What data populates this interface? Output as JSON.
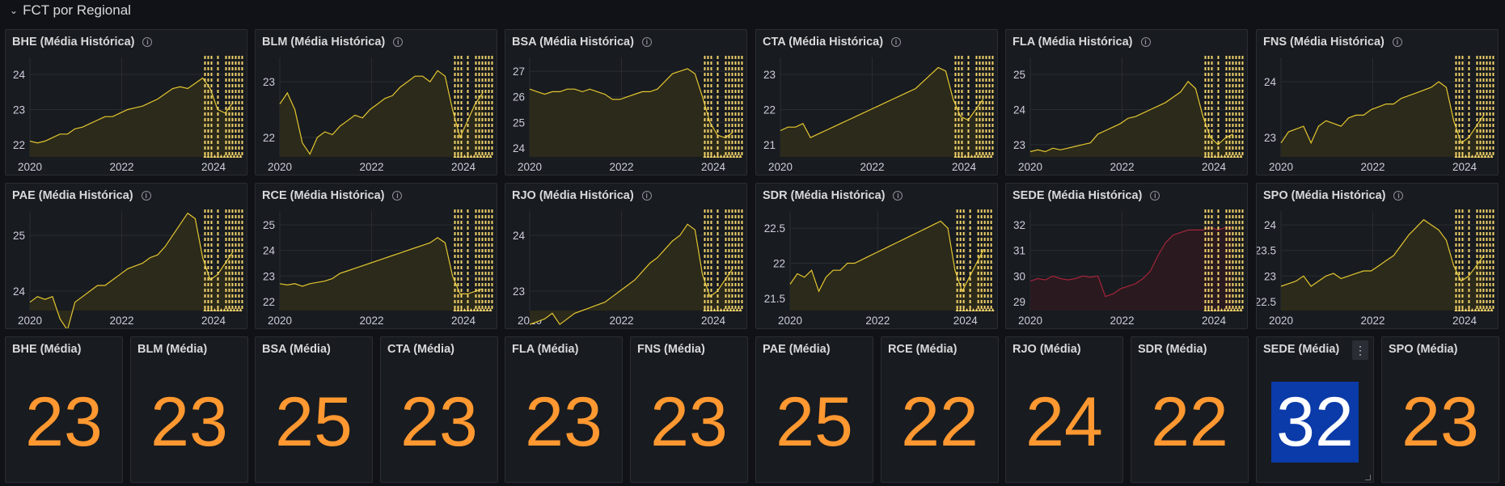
{
  "row": {
    "title": "FCT por Regional",
    "chevron": "chevron-down-icon"
  },
  "colors": {
    "line": "#e3c631",
    "fill": "#2c2a1a",
    "alert_line": "#a3243a",
    "alert_fill": "#2a1a1f",
    "stat": "#ff9830",
    "highlight_bg": "#0b3aa9"
  },
  "x_ticks": [
    "2020",
    "2022",
    "2024"
  ],
  "charts": [
    {
      "title": "BHE (Média Histórica)",
      "yticks": [
        "24",
        "23",
        "22"
      ],
      "series": [
        22.1,
        22.05,
        22.1,
        22.2,
        22.3,
        22.3,
        22.45,
        22.5,
        22.6,
        22.7,
        22.8,
        22.8,
        22.9,
        23.0,
        23.05,
        23.1,
        23.2,
        23.3,
        23.45,
        23.6,
        23.65,
        23.6,
        23.75,
        23.9,
        23.6,
        23.0,
        22.9,
        23.2
      ]
    },
    {
      "title": "BLM (Média Histórica)",
      "yticks": [
        "23",
        "22"
      ],
      "series": [
        22.6,
        22.8,
        22.5,
        21.9,
        21.7,
        22.0,
        22.1,
        22.05,
        22.2,
        22.3,
        22.4,
        22.35,
        22.5,
        22.6,
        22.7,
        22.75,
        22.9,
        23.0,
        23.1,
        23.1,
        23.0,
        23.2,
        23.1,
        22.5,
        22.0,
        22.3,
        22.6,
        22.8
      ]
    },
    {
      "title": "BSA (Média Histórica)",
      "yticks": [
        "27",
        "26",
        "25",
        "24"
      ],
      "series": [
        26.3,
        26.2,
        26.1,
        26.2,
        26.2,
        26.3,
        26.3,
        26.2,
        26.3,
        26.2,
        26.1,
        25.9,
        25.9,
        26.0,
        26.1,
        26.2,
        26.2,
        26.3,
        26.6,
        26.9,
        27.0,
        27.1,
        26.9,
        26.0,
        25.0,
        24.5,
        24.4,
        24.6
      ]
    },
    {
      "title": "CTA (Média Histórica)",
      "yticks": [
        "23",
        "22",
        "21"
      ],
      "series": [
        21.4,
        21.5,
        21.5,
        21.6,
        21.2,
        21.3,
        21.4,
        21.5,
        21.6,
        21.7,
        21.8,
        21.9,
        22.0,
        22.1,
        22.2,
        22.3,
        22.4,
        22.5,
        22.6,
        22.8,
        23.0,
        23.2,
        23.1,
        22.3,
        21.8,
        21.7,
        22.0,
        22.3
      ]
    },
    {
      "title": "FLA (Média Histórica)",
      "yticks": [
        "25",
        "24",
        "23"
      ],
      "series": [
        22.8,
        22.85,
        22.8,
        22.9,
        22.85,
        22.9,
        22.95,
        23.0,
        23.05,
        23.3,
        23.4,
        23.5,
        23.6,
        23.75,
        23.8,
        23.9,
        24.0,
        24.1,
        24.2,
        24.35,
        24.5,
        24.8,
        24.6,
        23.8,
        23.2,
        23.0,
        23.2,
        23.3
      ]
    },
    {
      "title": "FNS (Média Histórica)",
      "yticks": [
        "24",
        "23"
      ],
      "series": [
        22.9,
        23.1,
        23.15,
        23.2,
        22.9,
        23.2,
        23.3,
        23.25,
        23.2,
        23.35,
        23.4,
        23.4,
        23.5,
        23.55,
        23.6,
        23.6,
        23.7,
        23.75,
        23.8,
        23.85,
        23.9,
        24.0,
        23.9,
        23.3,
        22.9,
        23.0,
        23.2,
        23.4
      ]
    },
    {
      "title": "PAE (Média Histórica)",
      "yticks": [
        "25",
        "24"
      ],
      "series": [
        23.8,
        23.9,
        23.85,
        23.9,
        23.5,
        23.3,
        23.8,
        23.9,
        24.0,
        24.1,
        24.1,
        24.2,
        24.3,
        24.4,
        24.45,
        24.5,
        24.6,
        24.65,
        24.8,
        25.0,
        25.2,
        25.4,
        25.3,
        24.6,
        24.2,
        24.3,
        24.5,
        24.7
      ]
    },
    {
      "title": "RCE (Média Histórica)",
      "yticks": [
        "25",
        "24",
        "23",
        "22"
      ],
      "series": [
        22.7,
        22.65,
        22.7,
        22.6,
        22.7,
        22.75,
        22.8,
        22.9,
        23.1,
        23.2,
        23.3,
        23.4,
        23.5,
        23.6,
        23.7,
        23.8,
        23.9,
        24.0,
        24.1,
        24.2,
        24.3,
        24.5,
        24.3,
        23.0,
        22.3,
        22.3,
        22.4,
        22.5
      ]
    },
    {
      "title": "RJO (Média Histórica)",
      "yticks": [
        "24",
        "23"
      ],
      "series": [
        22.4,
        22.45,
        22.5,
        22.6,
        22.4,
        22.5,
        22.6,
        22.65,
        22.7,
        22.75,
        22.8,
        22.9,
        23.0,
        23.1,
        23.2,
        23.35,
        23.5,
        23.6,
        23.75,
        23.9,
        24.0,
        24.2,
        24.1,
        23.3,
        22.9,
        23.0,
        23.2,
        23.4
      ]
    },
    {
      "title": "SDR (Média Histórica)",
      "yticks": [
        "22.5",
        "22",
        "21.5"
      ],
      "series": [
        21.7,
        21.85,
        21.8,
        21.9,
        21.6,
        21.8,
        21.9,
        21.9,
        22.0,
        22.0,
        22.05,
        22.1,
        22.15,
        22.2,
        22.25,
        22.3,
        22.35,
        22.4,
        22.45,
        22.5,
        22.55,
        22.6,
        22.5,
        21.9,
        21.6,
        21.8,
        22.0,
        22.2
      ]
    },
    {
      "title": "SEDE (Média Histórica)",
      "yticks": [
        "32",
        "31",
        "30",
        "29"
      ],
      "series": [
        29.8,
        29.9,
        29.85,
        30.0,
        29.9,
        29.85,
        29.9,
        30.0,
        29.95,
        30.0,
        29.2,
        29.3,
        29.5,
        29.6,
        29.7,
        29.9,
        30.2,
        30.8,
        31.3,
        31.6,
        31.7,
        31.8,
        31.8,
        31.8,
        31.9,
        31.8,
        31.9,
        31.9
      ],
      "alert": true
    },
    {
      "title": "SPO (Média Histórica)",
      "yticks": [
        "24",
        "23.5",
        "23",
        "22.5"
      ],
      "series": [
        22.8,
        22.85,
        22.9,
        23.0,
        22.8,
        22.9,
        23.0,
        23.05,
        22.95,
        23.0,
        23.05,
        23.1,
        23.1,
        23.2,
        23.3,
        23.4,
        23.6,
        23.8,
        23.95,
        24.1,
        24.0,
        23.9,
        23.7,
        23.2,
        22.9,
        23.0,
        23.2,
        23.4
      ]
    }
  ],
  "stats": [
    {
      "title": "BHE (Média)",
      "value": "23"
    },
    {
      "title": "BLM (Média)",
      "value": "23"
    },
    {
      "title": "BSA (Média)",
      "value": "25"
    },
    {
      "title": "CTA (Média)",
      "value": "23"
    },
    {
      "title": "FLA (Média)",
      "value": "23"
    },
    {
      "title": "FNS (Média)",
      "value": "23"
    },
    {
      "title": "PAE (Média)",
      "value": "25"
    },
    {
      "title": "RCE (Média)",
      "value": "22"
    },
    {
      "title": "RJO (Média)",
      "value": "24"
    },
    {
      "title": "SDR (Média)",
      "value": "22"
    },
    {
      "title": "SEDE (Média)",
      "value": "32",
      "highlight": true,
      "menu_icon": "more-vertical-icon"
    },
    {
      "title": "SPO (Média)",
      "value": "23"
    }
  ]
}
